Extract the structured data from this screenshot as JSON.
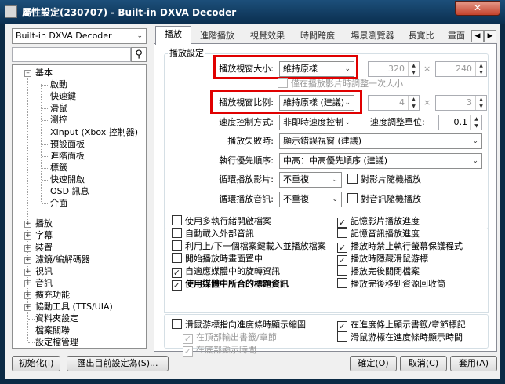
{
  "window": {
    "title": "屬性設定(230707) - Built-in DXVA Decoder",
    "close_label": "✕"
  },
  "filter_select": {
    "value": "Built-in DXVA Decoder"
  },
  "search": {
    "placeholder": "",
    "icon": "magnifier-icon"
  },
  "tree": {
    "root": "基本",
    "children": [
      "啟動",
      "快速鍵",
      "滑鼠",
      "瀏控",
      "XInput (Xbox 控制器)",
      "預設面板",
      "進階面板",
      "標籤",
      "快速開啟",
      "OSD 訊息",
      "介面"
    ],
    "sections": [
      "播放",
      "字幕",
      "裝置",
      "濾鏡/編解碼器",
      "視訊",
      "音訊",
      "擴充功能",
      "協動工具 (TTS/UIA)",
      "資料夾設定",
      "檔案關聯",
      "設定檔管理"
    ]
  },
  "tabs": [
    "播放",
    "進階播放",
    "視覺效果",
    "時間跨度",
    "場景瀏覽器",
    "長寬比",
    "畫面"
  ],
  "playback": {
    "group_title": "播放設定",
    "window_size_label": "播放視窗大小:",
    "window_size_value": "維持原樣",
    "width": "320",
    "height": "240",
    "times": "×",
    "adjust_once_label": "僅在播放影片時調整一次大小",
    "aspect_label": "播放視窗比例:",
    "aspect_value": "維持原樣 (建議)",
    "aspect_w": "4",
    "aspect_h": "3",
    "speed_label": "速度控制方式:",
    "speed_value": "非即時速度控制",
    "speed_unit_label": "速度調整單位:",
    "speed_unit_value": "0.1",
    "fail_label": "播放失敗時:",
    "fail_value": "顯示錯誤視窗 (建議)",
    "priority_label": "執行優先順序:",
    "priority_value": "中高：中高優先順序 (建議)",
    "loop_video_label": "循環播放影片:",
    "loop_video_value": "不重複",
    "shuffle_video_label": "對影片隨機播放",
    "loop_audio_label": "循環播放音訊:",
    "loop_audio_value": "不重複",
    "shuffle_audio_label": "對音訊隨機播放"
  },
  "options_left": [
    {
      "label": "使用多執行緒開啟檔案",
      "checked": false
    },
    {
      "label": "自動載入外部音訊",
      "checked": false
    },
    {
      "label": "利用上/下一個檔案鍵載入並播放檔案",
      "checked": false
    },
    {
      "label": "開始播放時畫面置中",
      "checked": false
    },
    {
      "label": "自適應媒體中的旋轉資訊",
      "checked": true
    },
    {
      "label": "使用媒體中所合的標題資訊",
      "checked": true
    }
  ],
  "options_right": [
    {
      "label": "記憶影片播放進度",
      "checked": true
    },
    {
      "label": "記憶音訊播放進度",
      "checked": false
    },
    {
      "label": "播放時禁止執行螢幕保護程式",
      "checked": true
    },
    {
      "label": "播放時隱藏滑鼠游標",
      "checked": true
    },
    {
      "label": "播放完後關閉檔案",
      "checked": false
    },
    {
      "label": "播放完後移到資源回收筒",
      "checked": false
    }
  ],
  "seek_left": {
    "main": "滑鼠游標指向進度條時顯示縮圖",
    "sub1": "在頂部輸出書籤/章節",
    "sub2": "在底部顯示時間"
  },
  "seek_right": {
    "opt1": "在進度條上顯示書籤/章節標記",
    "opt2": "滑鼠游標在進度條時顯示時間"
  },
  "footer": {
    "initialize": "初始化(I)",
    "export": "匯出目前設定為(S)...",
    "ok": "確定(O)",
    "cancel": "取消(C)",
    "apply": "套用(A)"
  },
  "colors": {
    "highlight": "#e00000",
    "title_bar": "#0b2f50"
  }
}
